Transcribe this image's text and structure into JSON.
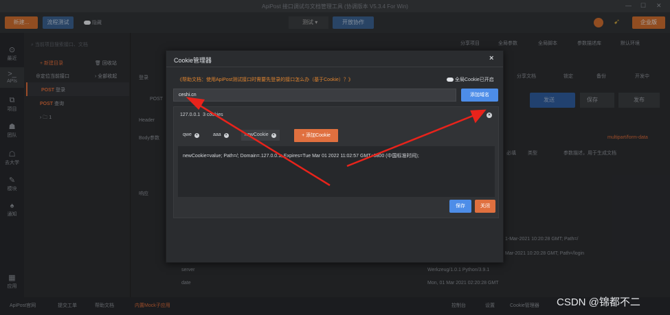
{
  "app": {
    "title": "ApiPost 接口调试与文档管理工具 (协调版本 V5.3.4 For Win)",
    "new_label": "新建...",
    "flow_test_label": "流程测试",
    "hide_label": "隐藏",
    "env_label": "测试",
    "collab_label": "开放协作",
    "enterprise_label": "企业版"
  },
  "nav": {
    "items": [
      {
        "icon": "clock-icon",
        "label": "最近"
      },
      {
        "icon": "api-icon",
        "label": "APIs"
      },
      {
        "icon": "project-icon",
        "label": "项目"
      },
      {
        "icon": "team-icon",
        "label": "团队"
      },
      {
        "icon": "school-icon",
        "label": "去大学"
      },
      {
        "icon": "edit-icon",
        "label": "模块"
      },
      {
        "icon": "bell-icon",
        "label": "通知"
      },
      {
        "icon": "apps-icon",
        "label": "应用"
      }
    ]
  },
  "tree": {
    "search_placeholder": "当前项目搜索接口、文档",
    "new_dir": "+ 新建目录",
    "recycle": "回收站",
    "locate": "定位当前接口",
    "collapse": "全部收起",
    "rows": [
      {
        "method": "POST",
        "name": "登录"
      },
      {
        "method": "POST",
        "name": "查询"
      }
    ],
    "folder": "1"
  },
  "main": {
    "share_project": "分享项目",
    "global_params": "全局参数",
    "global_script": "全局脚本",
    "param_desc": "参数描述库",
    "env_default": "默认环境",
    "tab_label": "登录",
    "share_doc": "分享文档",
    "lock": "锁定",
    "backup": "备份",
    "dev_status": "开发中",
    "method": "POST",
    "send": "发送",
    "save": "保存",
    "publish": "发布",
    "header_tab": "Header",
    "body_label": "Body参数",
    "multipart": "multipart/form-data",
    "required": "必填",
    "type": "类型",
    "param_desc_ph": "参数描述，用于生成文档",
    "resp_tab1": "响应",
    "cookie_line1": "1-Mar-2021 10:20:28 GMT; Path=/",
    "cookie_line2": "Mar-2021 10:20:28 GMT; Path=/login",
    "server_key": "server",
    "server_val": "Werkzeug/1.0.1 Python/3.9.1",
    "date_key": "date",
    "date_val": "Mon, 01 Mar 2021 02:20:28 GMT"
  },
  "footer": {
    "website": "ApiPost官网",
    "ticket": "提交工单",
    "help": "帮助文档",
    "mock": "内置Mock子应用",
    "console": "控制台",
    "settings": "设置",
    "cookie_manager": "Cookie管理器"
  },
  "modal": {
    "title": "Cookie管理器",
    "help_text": "《帮助文档：使用ApiPost测试接口时需要先登录的接口怎么办（基于Cookie）？》",
    "global_cookie": "全局Cookie已开启",
    "domain_value": "ceshi.cn",
    "add_domain": "添加域名",
    "cookie_domain": "127.0.0.1",
    "cookie_count": "3 cookies",
    "tags": [
      "qwe",
      "aaa",
      "newCookie"
    ],
    "add_cookie": "+ 添加Cookie",
    "cookie_text": "newCookie=value; Path=/; Domain=.127.0.0.1; Expires=Tue Mar 01 2022 11:02:57 GMT+0800 (中国标准时间);",
    "save": "保存",
    "close": "关闭"
  },
  "watermark": "CSDN @锦都不二",
  "colors": {
    "accent_blue": "#4d8de8",
    "accent_orange": "#e0703f",
    "arrow_red": "#e8231b"
  }
}
